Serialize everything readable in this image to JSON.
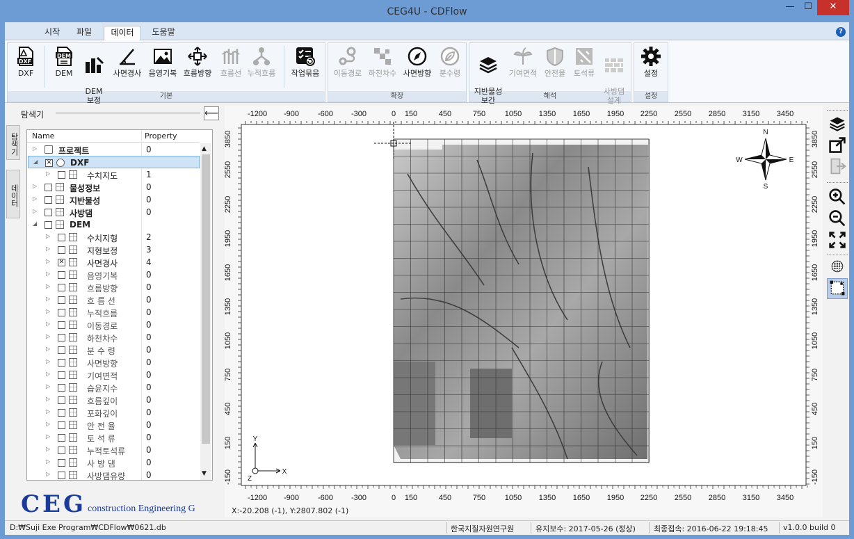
{
  "window": {
    "title": "CEG4U - CDFlow",
    "min": "—",
    "max": "☐",
    "close": "✕"
  },
  "tabs": [
    {
      "label": "시작"
    },
    {
      "label": "파일"
    },
    {
      "label": "데이터",
      "active": true
    },
    {
      "label": "도움말"
    }
  ],
  "help": "?",
  "ribbon": {
    "groups": [
      {
        "label": "기본",
        "buttons": [
          {
            "label": "DXF",
            "icon": "dxf-file-icon",
            "enabled": true
          },
          {
            "label": "DEM",
            "icon": "dem-file-icon",
            "enabled": true
          },
          {
            "label": "DEM\n보정",
            "icon": "dem-correction-icon",
            "enabled": true
          },
          {
            "label": "사면경사",
            "icon": "slope-icon",
            "enabled": true
          },
          {
            "label": "음영기복",
            "icon": "hillshade-icon",
            "enabled": true
          },
          {
            "label": "흐름방향",
            "icon": "flow-direction-icon",
            "enabled": true
          },
          {
            "label": "흐름선",
            "icon": "flowline-icon",
            "enabled": false
          },
          {
            "label": "누적흐름",
            "icon": "flow-accumulation-icon",
            "enabled": false
          },
          {
            "label": "작업묶음",
            "icon": "batch-task-icon",
            "enabled": true
          }
        ]
      },
      {
        "label": "확장",
        "buttons": [
          {
            "label": "이동경로",
            "icon": "path-icon",
            "enabled": false
          },
          {
            "label": "하천차수",
            "icon": "stream-order-icon",
            "enabled": false
          },
          {
            "label": "사면방향",
            "icon": "compass-icon",
            "enabled": true
          },
          {
            "label": "분수령",
            "icon": "watershed-icon",
            "enabled": false
          }
        ]
      },
      {
        "label": "해석",
        "buttons": [
          {
            "label": "지반물성\n보간",
            "icon": "layers-icon",
            "enabled": true
          },
          {
            "label": "기여면적",
            "icon": "contributing-area-icon",
            "enabled": false
          },
          {
            "label": "안전율",
            "icon": "shield-icon",
            "enabled": false
          },
          {
            "label": "토석류",
            "icon": "debris-flow-icon",
            "enabled": false
          },
          {
            "label": "사방댐\n설계",
            "icon": "dam-wall-icon",
            "enabled": false
          }
        ]
      },
      {
        "label": "설정",
        "buttons": [
          {
            "label": "설정",
            "icon": "gear-icon",
            "enabled": true
          }
        ]
      }
    ]
  },
  "explorer": {
    "title": "탐색기",
    "back": "⟵",
    "side_tabs": [
      "탐색기",
      "데이터"
    ],
    "columns": [
      "Name",
      "Property"
    ],
    "rows": [
      {
        "name": "프로젝트",
        "value": "0",
        "level": 0,
        "bold": true,
        "checkbox": false,
        "twisty": "▷",
        "icon": "project-icon"
      },
      {
        "name": "DXF",
        "value": "",
        "level": 0,
        "bold": true,
        "checked": true,
        "twisty": "◢",
        "icon": "dxf-node-icon",
        "selected": true
      },
      {
        "name": "수치지도",
        "value": "1",
        "level": 1,
        "checked": false,
        "twisty": "▷"
      },
      {
        "name": "물성정보",
        "value": "0",
        "level": 0,
        "bold": true,
        "checked": false,
        "twisty": "▷"
      },
      {
        "name": "지반물성",
        "value": "0",
        "level": 0,
        "bold": true,
        "checked": false,
        "twisty": "▷"
      },
      {
        "name": "사방댐",
        "value": "0",
        "level": 0,
        "bold": true,
        "checked": false,
        "twisty": "▷"
      },
      {
        "name": "DEM",
        "value": "",
        "level": 0,
        "bold": true,
        "checked": false,
        "twisty": "◢"
      },
      {
        "name": "수치지형",
        "value": "2",
        "level": 1,
        "checked": false,
        "twisty": "▷"
      },
      {
        "name": "지형보정",
        "value": "3",
        "level": 1,
        "checked": false,
        "twisty": "▷"
      },
      {
        "name": "사면경사",
        "value": "4",
        "level": 1,
        "checked": true,
        "twisty": "▷"
      },
      {
        "name": "음영기복",
        "value": "0",
        "level": 1,
        "checked": false,
        "twisty": "▷",
        "dim": true
      },
      {
        "name": "흐름방향",
        "value": "0",
        "level": 1,
        "checked": false,
        "twisty": "▷",
        "dim": true
      },
      {
        "name": "흐 름 선",
        "value": "0",
        "level": 1,
        "checked": false,
        "twisty": "▷",
        "dim": true
      },
      {
        "name": "누적흐름",
        "value": "0",
        "level": 1,
        "checked": false,
        "twisty": "▷",
        "dim": true
      },
      {
        "name": "이동경로",
        "value": "0",
        "level": 1,
        "checked": false,
        "twisty": "▷",
        "dim": true
      },
      {
        "name": "하천차수",
        "value": "0",
        "level": 1,
        "checked": false,
        "twisty": "▷",
        "dim": true
      },
      {
        "name": "분 수 령",
        "value": "0",
        "level": 1,
        "checked": false,
        "twisty": "▷",
        "dim": true
      },
      {
        "name": "사면방향",
        "value": "0",
        "level": 1,
        "checked": false,
        "twisty": "▷",
        "dim": true
      },
      {
        "name": "기여면적",
        "value": "0",
        "level": 1,
        "checked": false,
        "twisty": "▷",
        "dim": true
      },
      {
        "name": "습윤지수",
        "value": "0",
        "level": 1,
        "checked": false,
        "twisty": "▷",
        "dim": true
      },
      {
        "name": "흐름깊이",
        "value": "0",
        "level": 1,
        "checked": false,
        "twisty": "▷",
        "dim": true
      },
      {
        "name": "포화깊이",
        "value": "0",
        "level": 1,
        "checked": false,
        "twisty": "▷",
        "dim": true
      },
      {
        "name": "안 전 율",
        "value": "0",
        "level": 1,
        "checked": false,
        "twisty": "▷",
        "dim": true
      },
      {
        "name": "토 석 류",
        "value": "0",
        "level": 1,
        "checked": false,
        "twisty": "▷",
        "dim": true
      },
      {
        "name": "누적토석류",
        "value": "0",
        "level": 1,
        "checked": false,
        "twisty": "▷",
        "dim": true
      },
      {
        "name": "사 방 댐",
        "value": "0",
        "level": 1,
        "checked": false,
        "twisty": "▷",
        "dim": true
      },
      {
        "name": "사방댐유량",
        "value": "0",
        "level": 1,
        "checked": false,
        "twisty": "▷",
        "dim": true
      }
    ]
  },
  "logo": {
    "mark": "CEG",
    "text": "construction Engineering Group"
  },
  "map": {
    "x_ticks": [
      "-1200",
      "-900",
      "-600",
      "-300",
      "0",
      "150",
      "450",
      "750",
      "1050",
      "1350",
      "1650",
      "1950",
      "2250",
      "2550",
      "2850",
      "3150",
      "3450"
    ],
    "y_ticks": [
      "3850",
      "2550",
      "2250",
      "1950",
      "1650",
      "1350",
      "1050",
      "750",
      "450",
      "150",
      "-150"
    ],
    "compass": {
      "n": "N",
      "s": "S",
      "e": "E",
      "w": "W"
    },
    "axes": {
      "x": "X",
      "y": "Y",
      "z": "Z"
    },
    "coordinate_readout": "X:-20.208 (-1), Y:2807.802 (-1)"
  },
  "right_toolbar": [
    "layers-icon",
    "export-icon",
    "import-icon",
    "zoom-in-icon",
    "zoom-out-icon",
    "fit-extent-icon",
    "grid-points-icon",
    "select-grid-icon"
  ],
  "status": {
    "path": "D:₩Suji Exe Program₩CDFlow₩0621.db",
    "org": "한국지질자원연구원",
    "maintenance": "유지보수: 2017-05-26 (정상)",
    "last_access": "최종접속: 2016-06-22 19:18:45",
    "version": "v1.0.0 build 0"
  }
}
